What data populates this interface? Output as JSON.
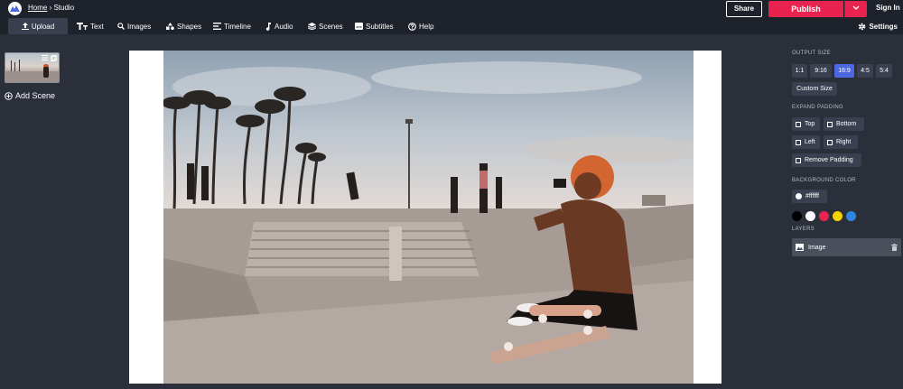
{
  "header": {
    "breadcrumb_home": "Home",
    "breadcrumb_separator": " › ",
    "breadcrumb_current": "Studio",
    "share_label": "Share",
    "publish_label": "Publish",
    "signin_label": "Sign In"
  },
  "toolbar": {
    "items": [
      {
        "label": "Upload",
        "icon": "upload-icon"
      },
      {
        "label": "Text",
        "icon": "text-icon"
      },
      {
        "label": "Images",
        "icon": "search-icon"
      },
      {
        "label": "Shapes",
        "icon": "shapes-icon"
      },
      {
        "label": "Timeline",
        "icon": "timeline-icon"
      },
      {
        "label": "Audio",
        "icon": "music-note-icon"
      },
      {
        "label": "Scenes",
        "icon": "layers-icon"
      },
      {
        "label": "Subtitles",
        "icon": "subtitles-icon"
      },
      {
        "label": "Help",
        "icon": "help-icon"
      }
    ],
    "settings_label": "Settings"
  },
  "scenes": {
    "add_label": "Add Scene"
  },
  "sidebar": {
    "output_size_label": "OUTPUT SIZE",
    "sizes": [
      "1:1",
      "9:16",
      "16:9",
      "4:5",
      "5:4"
    ],
    "active_size": "16:9",
    "custom_size_label": "Custom Size",
    "expand_padding_label": "EXPAND PADDING",
    "padding": {
      "top": "Top",
      "bottom": "Bottom",
      "left": "Left",
      "right": "Right",
      "remove": "Remove Padding"
    },
    "background_color_label": "BACKGROUND COLOR",
    "background_color_value": "#ffffff",
    "swatches": [
      "#000000",
      "#ffffff",
      "#e8234f",
      "#f5d400",
      "#2f86e0"
    ],
    "layers_label": "LAYERS",
    "layers": [
      {
        "name": "Image"
      }
    ]
  },
  "colors": {
    "accent": "#e8234f",
    "selected": "#4b68e0",
    "panel": "#2b2f3a",
    "topbar": "#1e222b"
  }
}
